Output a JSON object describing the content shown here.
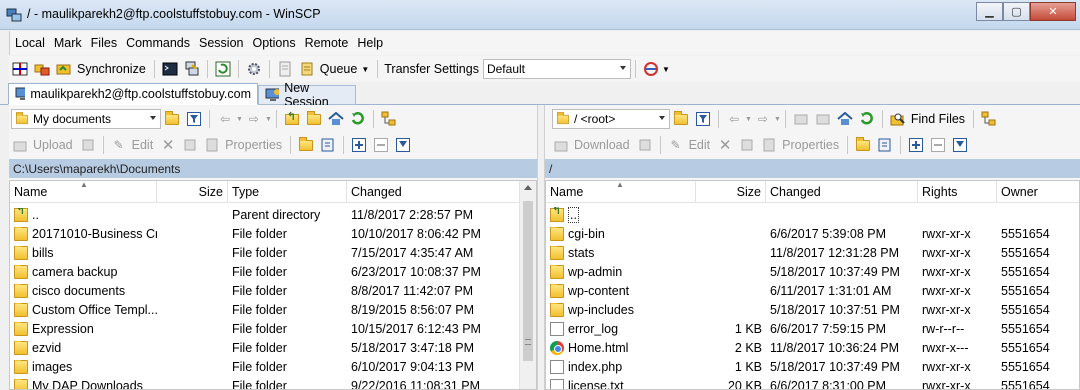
{
  "window": {
    "title": "/ - maulikparekh2@ftp.coolstuffstobuy.com - WinSCP"
  },
  "menu": [
    "Local",
    "Mark",
    "Files",
    "Commands",
    "Session",
    "Options",
    "Remote",
    "Help"
  ],
  "toolbar": {
    "synchronize_label": "Synchronize",
    "queue_label": "Queue",
    "transfer_settings_label": "Transfer Settings",
    "transfer_settings_value": "Default"
  },
  "tabs": {
    "session_label": "maulikparekh2@ftp.coolstuffstobuy.com",
    "new_session_label": "New Session"
  },
  "left": {
    "location": "My documents",
    "path": "C:\\Users\\maparekh\\Documents",
    "actions": {
      "upload": "Upload",
      "edit": "Edit",
      "properties": "Properties"
    },
    "columns": [
      "Name",
      "Size",
      "Type",
      "Changed"
    ],
    "rows": [
      {
        "icon": "up-folder-icon",
        "name": "..",
        "size": "",
        "type": "Parent directory",
        "changed": "11/8/2017  2:28:57 PM"
      },
      {
        "icon": "folder-icon",
        "name": "20171010-Business Cr...",
        "size": "",
        "type": "File folder",
        "changed": "10/10/2017  8:06:42 PM"
      },
      {
        "icon": "folder-icon",
        "name": "bills",
        "size": "",
        "type": "File folder",
        "changed": "7/15/2017  4:35:47 AM"
      },
      {
        "icon": "folder-icon",
        "name": "camera backup",
        "size": "",
        "type": "File folder",
        "changed": "6/23/2017  10:08:37 PM"
      },
      {
        "icon": "folder-icon",
        "name": "cisco documents",
        "size": "",
        "type": "File folder",
        "changed": "8/8/2017  11:42:07 PM"
      },
      {
        "icon": "folder-icon",
        "name": "Custom Office Templ...",
        "size": "",
        "type": "File folder",
        "changed": "8/19/2015  8:56:07 PM"
      },
      {
        "icon": "folder-icon",
        "name": "Expression",
        "size": "",
        "type": "File folder",
        "changed": "10/15/2017  6:12:43 PM"
      },
      {
        "icon": "folder-icon",
        "name": "ezvid",
        "size": "",
        "type": "File folder",
        "changed": "5/18/2017  3:47:18 PM"
      },
      {
        "icon": "folder-icon",
        "name": "images",
        "size": "",
        "type": "File folder",
        "changed": "6/10/2017  9:04:13 PM"
      },
      {
        "icon": "folder-icon",
        "name": "My DAP Downloads",
        "size": "",
        "type": "File folder",
        "changed": "9/22/2016  11:08:31 PM"
      }
    ]
  },
  "right": {
    "location": "/ <root>",
    "path": "/",
    "find_files_label": "Find Files",
    "actions": {
      "download": "Download",
      "edit": "Edit",
      "properties": "Properties"
    },
    "columns": [
      "Name",
      "Size",
      "Changed",
      "Rights",
      "Owner"
    ],
    "rows": [
      {
        "icon": "up-folder-icon",
        "name": "..",
        "size": "",
        "changed": "",
        "rights": "",
        "owner": ""
      },
      {
        "icon": "folder-icon",
        "name": "cgi-bin",
        "size": "",
        "changed": "6/6/2017  5:39:08 PM",
        "rights": "rwxr-xr-x",
        "owner": "5551654"
      },
      {
        "icon": "folder-icon",
        "name": "stats",
        "size": "",
        "changed": "11/8/2017  12:31:28 PM",
        "rights": "rwxr-xr-x",
        "owner": "5551654"
      },
      {
        "icon": "folder-icon",
        "name": "wp-admin",
        "size": "",
        "changed": "5/18/2017  10:37:49 PM",
        "rights": "rwxr-xr-x",
        "owner": "5551654"
      },
      {
        "icon": "folder-icon",
        "name": "wp-content",
        "size": "",
        "changed": "6/11/2017  1:31:01 AM",
        "rights": "rwxr-xr-x",
        "owner": "5551654"
      },
      {
        "icon": "folder-icon",
        "name": "wp-includes",
        "size": "",
        "changed": "5/18/2017  10:37:51 PM",
        "rights": "rwxr-xr-x",
        "owner": "5551654"
      },
      {
        "icon": "file-icon",
        "name": "error_log",
        "size": "1 KB",
        "changed": "6/6/2017  7:59:15 PM",
        "rights": "rw-r--r--",
        "owner": "5551654"
      },
      {
        "icon": "chrome-html-icon",
        "name": "Home.html",
        "size": "2 KB",
        "changed": "11/8/2017  10:36:24 PM",
        "rights": "rwxr-x---",
        "owner": "5551654"
      },
      {
        "icon": "php-file-icon",
        "name": "index.php",
        "size": "1 KB",
        "changed": "5/18/2017  10:37:49 PM",
        "rights": "rwxr-xr-x",
        "owner": "5551654"
      },
      {
        "icon": "file-icon",
        "name": "license.txt",
        "size": "20 KB",
        "changed": "6/6/2017  8:31:00 PM",
        "rights": "rwxr-xr-x",
        "owner": "5551654"
      }
    ]
  }
}
